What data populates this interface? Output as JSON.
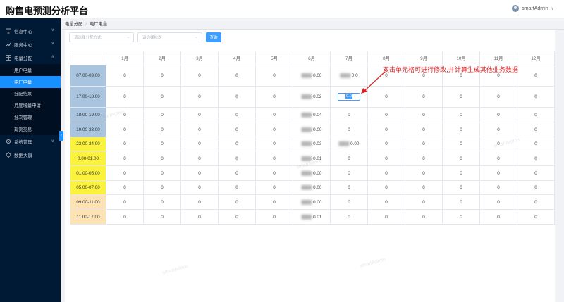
{
  "app": {
    "title": "购售电预测分析平台",
    "user_name": "smartAdmin",
    "user_caret": "∨"
  },
  "sidebar": {
    "items": [
      {
        "label": "信息中心",
        "icon": "monitor-icon",
        "chevron": "∨"
      },
      {
        "label": "服务中心",
        "icon": "chart-line-icon",
        "chevron": "∨"
      },
      {
        "label": "电量分配",
        "icon": "grid-icon",
        "chevron": "∧"
      },
      {
        "label": "系统管理",
        "icon": "gear-icon",
        "chevron": "∨"
      },
      {
        "label": "数据大屏",
        "icon": "screen-icon",
        "chevron": ""
      }
    ],
    "sub_items": [
      "用户电量",
      "电厂电量",
      "分配结果",
      "月度增量申请",
      "批次管理",
      "现货交易"
    ],
    "active_sub_index": 1,
    "collapse_glyph": "‹"
  },
  "breadcrumb": {
    "items": [
      "电量分配",
      "电厂电量"
    ],
    "separator": "/"
  },
  "filters": {
    "select1_placeholder": "请选择分配方式",
    "select2_placeholder": "请选择批次",
    "select_caret": "⌄",
    "search_button": "查询"
  },
  "table": {
    "months": [
      "1月",
      "2月",
      "3月",
      "4月",
      "5月",
      "6月",
      "7月",
      "8月",
      "9月",
      "10月",
      "11月",
      "12月"
    ],
    "rows": [
      {
        "slot": "07.00-09.00",
        "color": "blue",
        "cells": [
          "0",
          "0",
          "0",
          "0",
          "0",
          "0.00",
          "0.0",
          "0",
          "0",
          "0",
          "0",
          "0"
        ]
      },
      {
        "slot": "17.00-18.00",
        "color": "blue",
        "cells": [
          "0",
          "0",
          "0",
          "0",
          "0",
          "0.02",
          "EDIT",
          "0",
          "0",
          "0",
          "0",
          "0"
        ]
      },
      {
        "slot": "18.00-19.00",
        "color": "blue",
        "cells": [
          "0",
          "0",
          "0",
          "0",
          "0",
          "0.04",
          "0",
          "0",
          "0",
          "0",
          "0",
          "0"
        ]
      },
      {
        "slot": "19.00-23.00",
        "color": "blue",
        "cells": [
          "0",
          "0",
          "0",
          "0",
          "0",
          "0.00",
          "0",
          "0",
          "0",
          "0",
          "0",
          "0"
        ]
      },
      {
        "slot": "23.00-24.00",
        "color": "yellow",
        "cells": [
          "0",
          "0",
          "0",
          "0",
          "0",
          "0.03",
          "0.00",
          "0",
          "0",
          "0",
          "0",
          "0"
        ]
      },
      {
        "slot": "0.00-01.00",
        "color": "yellow",
        "cells": [
          "0",
          "0",
          "0",
          "0",
          "0",
          "0.01",
          "0",
          "0",
          "0",
          "0",
          "0",
          "0"
        ]
      },
      {
        "slot": "01.00-05.00",
        "color": "yellow",
        "cells": [
          "0",
          "0",
          "0",
          "0",
          "0",
          "0.00",
          "0",
          "0",
          "0",
          "0",
          "0",
          "0"
        ]
      },
      {
        "slot": "05.00-07.00",
        "color": "yellow",
        "cells": [
          "0",
          "0",
          "0",
          "0",
          "0",
          "0.00",
          "0",
          "0",
          "0",
          "0",
          "0",
          "0"
        ]
      },
      {
        "slot": "09.00-11.00",
        "color": "peach",
        "cells": [
          "0",
          "0",
          "0",
          "0",
          "0",
          "0.00",
          "0",
          "0",
          "0",
          "0",
          "0",
          "0"
        ]
      },
      {
        "slot": "11.00-17.00",
        "color": "peach",
        "cells": [
          "0",
          "0",
          "0",
          "0",
          "0",
          "0.01",
          "0",
          "0",
          "0",
          "0",
          "0",
          "0"
        ]
      }
    ],
    "editing_value": "0.0"
  },
  "annotation": "双击单元格可进行修改,并计算生成其他业务数据",
  "watermark": "smartAdmin",
  "colors": {
    "sidebar_bg": "#001a36",
    "accent": "#1890ff",
    "annotation": "#e02020"
  }
}
